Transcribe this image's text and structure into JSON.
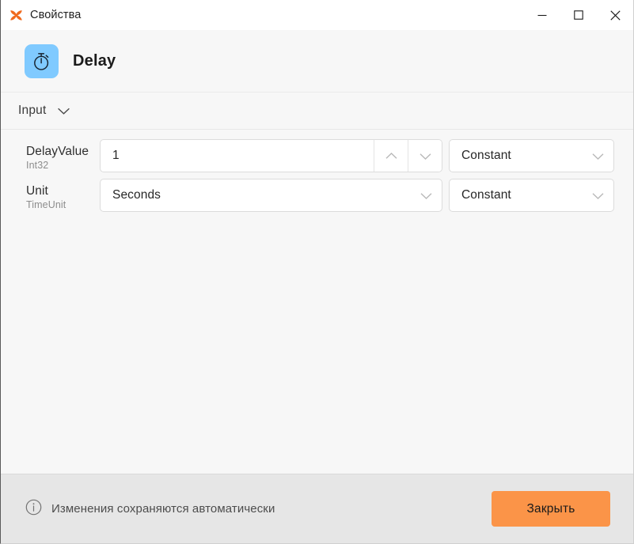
{
  "window": {
    "title": "Свойства",
    "app_icon": "uipath-butterfly-icon",
    "controls": {
      "minimize_label": "Свернуть",
      "maximize_label": "Развернуть",
      "close_label": "Закрыть окно"
    }
  },
  "activity": {
    "name": "Delay",
    "icon": "stopwatch-icon",
    "icon_bg": "#80caff"
  },
  "section": {
    "label": "Input",
    "expanded": true,
    "chevron": "chevron-down-icon"
  },
  "fields": [
    {
      "name": "DelayValue",
      "type": "Int32",
      "control": "number-stepper",
      "value": "1",
      "increment_icon": "chevron-up-icon",
      "decrement_icon": "chevron-down-icon",
      "mode": "Constant",
      "mode_chevron": "chevron-down-icon"
    },
    {
      "name": "Unit",
      "type": "TimeUnit",
      "control": "dropdown",
      "value": "Seconds",
      "value_chevron": "chevron-down-icon",
      "mode": "Constant",
      "mode_chevron": "chevron-down-icon"
    }
  ],
  "footer": {
    "info_icon": "info-circle-icon",
    "note": "Изменения сохраняются автоматически",
    "close_button": "Закрыть",
    "close_button_color": "#fb9448"
  }
}
